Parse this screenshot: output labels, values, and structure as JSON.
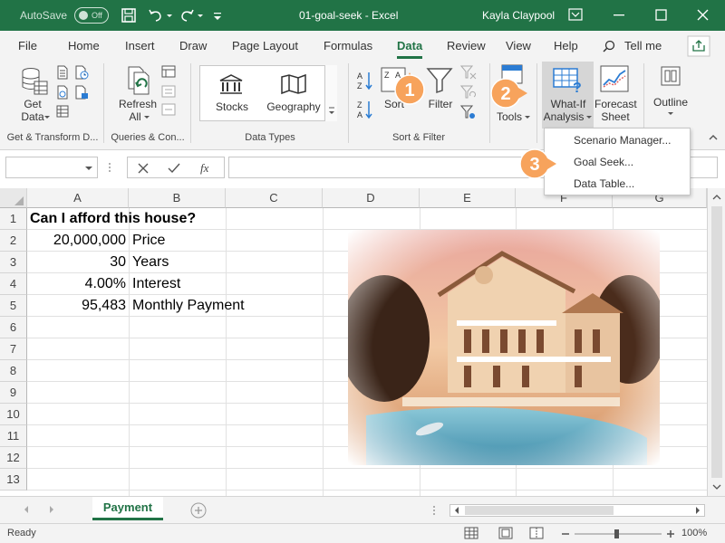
{
  "titlebar": {
    "autosave_label": "AutoSave",
    "autosave_state": "Off",
    "document_title": "01-goal-seek  -  Excel",
    "user_name": "Kayla Claypool"
  },
  "tabs": [
    "File",
    "Home",
    "Insert",
    "Draw",
    "Page Layout",
    "Formulas",
    "Data",
    "Review",
    "View",
    "Help",
    "Tell me"
  ],
  "active_tab": "Data",
  "ribbon": {
    "get_data_label": "Get",
    "get_data_label2": "Data",
    "refresh_label": "Refresh",
    "refresh_label2": "All",
    "stocks_label": "Stocks",
    "geography_label": "Geography",
    "sort_label": "Sort",
    "filter_label": "Filter",
    "tools_label": "Tools",
    "whatif_label": "What-If",
    "whatif_label2": "Analysis",
    "forecast_label": "Forecast",
    "forecast_label2": "Sheet",
    "outline_label": "Outline",
    "groups": {
      "get_transform": "Get & Transform D...",
      "queries": "Queries & Con...",
      "data_types": "Data Types",
      "sort_filter": "Sort & Filter"
    }
  },
  "whatif_menu": {
    "items": [
      "Scenario Manager...",
      "Goal Seek...",
      "Data Table..."
    ]
  },
  "callouts": [
    "1",
    "2",
    "3"
  ],
  "formula_bar": {
    "name_box": "",
    "fx_label": "fx",
    "formula": ""
  },
  "columns": [
    "A",
    "B",
    "C",
    "D",
    "E",
    "F",
    "G"
  ],
  "rows": [
    "1",
    "2",
    "3",
    "4",
    "5",
    "6",
    "7",
    "8",
    "9",
    "10",
    "11",
    "12",
    "13"
  ],
  "cells": {
    "a1": "Can I afford this house?",
    "a2": "20,000,000",
    "b2": "Price",
    "a3": "30",
    "b3": "Years",
    "a4": "4.00%",
    "b4": "Interest",
    "a5": "95,483",
    "b5": "Monthly Payment"
  },
  "sheet_tabs": [
    "Payment"
  ],
  "status": {
    "ready": "Ready",
    "zoom": "100%"
  },
  "colors": {
    "accent": "#217346",
    "callout": "#f7a35c"
  }
}
